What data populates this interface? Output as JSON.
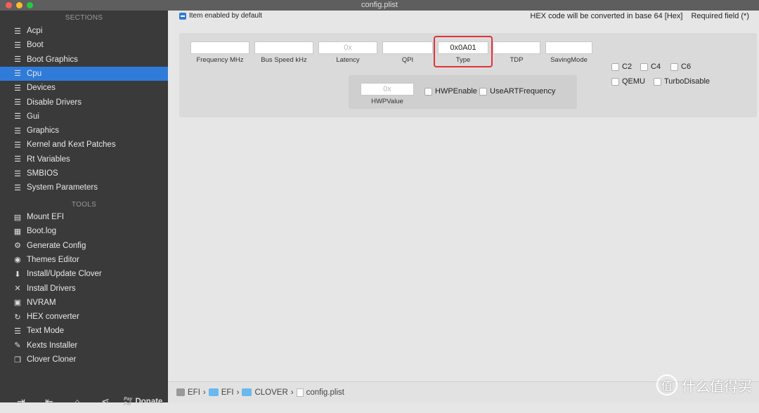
{
  "window": {
    "title": "config.plist"
  },
  "sidebar": {
    "sections_header": "SECTIONS",
    "sections": [
      {
        "label": "Acpi"
      },
      {
        "label": "Boot"
      },
      {
        "label": "Boot Graphics"
      },
      {
        "label": "Cpu",
        "selected": true
      },
      {
        "label": "Devices"
      },
      {
        "label": "Disable Drivers"
      },
      {
        "label": "Gui"
      },
      {
        "label": "Graphics"
      },
      {
        "label": "Kernel and Kext Patches"
      },
      {
        "label": "Rt Variables"
      },
      {
        "label": "SMBIOS"
      },
      {
        "label": "System Parameters"
      }
    ],
    "tools_header": "TOOLS",
    "tools": [
      {
        "label": "Mount EFI",
        "icon": "disk-icon"
      },
      {
        "label": "Boot.log",
        "icon": "log-icon"
      },
      {
        "label": "Generate Config",
        "icon": "gear-icon"
      },
      {
        "label": "Themes Editor",
        "icon": "palette-icon"
      },
      {
        "label": "Install/Update Clover",
        "icon": "download-icon"
      },
      {
        "label": "Install Drivers",
        "icon": "tools-icon"
      },
      {
        "label": "NVRAM",
        "icon": "chip-icon"
      },
      {
        "label": "HEX converter",
        "icon": "refresh-icon"
      },
      {
        "label": "Text Mode",
        "icon": "text-icon"
      },
      {
        "label": "Kexts Installer",
        "icon": "puzzle-icon"
      },
      {
        "label": "Clover Cloner",
        "icon": "copy-icon"
      }
    ],
    "bottom": {
      "paypal": "PayPal",
      "donate": "Donate"
    }
  },
  "main": {
    "enabled_note": "Item enabled by default",
    "hex_note": "HEX code will be converted in base 64 [Hex]",
    "required_note": "Required field (*)",
    "fields": [
      {
        "label": "Frequency MHz",
        "value": "",
        "placeholder": ""
      },
      {
        "label": "Bus Speed kHz",
        "value": "",
        "placeholder": ""
      },
      {
        "label": "Latency",
        "value": "",
        "placeholder": "0x"
      },
      {
        "label": "QPI",
        "value": "",
        "placeholder": ""
      },
      {
        "label": "Type",
        "value": "0x0A01",
        "placeholder": "",
        "highlighted": true
      },
      {
        "label": "TDP",
        "value": "",
        "placeholder": ""
      },
      {
        "label": "SavingMode",
        "value": "",
        "placeholder": ""
      }
    ],
    "hwp": {
      "label": "HWPValue",
      "placeholder": "0x"
    },
    "checkboxes": [
      {
        "label": "HWPEnable",
        "checked": false
      },
      {
        "label": "UseARTFrequency",
        "checked": false
      },
      {
        "label": "C2",
        "checked": false
      },
      {
        "label": "C4",
        "checked": false
      },
      {
        "label": "C6",
        "checked": false
      },
      {
        "label": "QEMU",
        "checked": false
      },
      {
        "label": "TurboDisable",
        "checked": false
      }
    ],
    "path": [
      "EFI",
      "EFI",
      "CLOVER",
      "config.plist"
    ],
    "highlight_color": "#e0333a",
    "accent": "#2f7bd9"
  },
  "watermark": "什么值得买"
}
